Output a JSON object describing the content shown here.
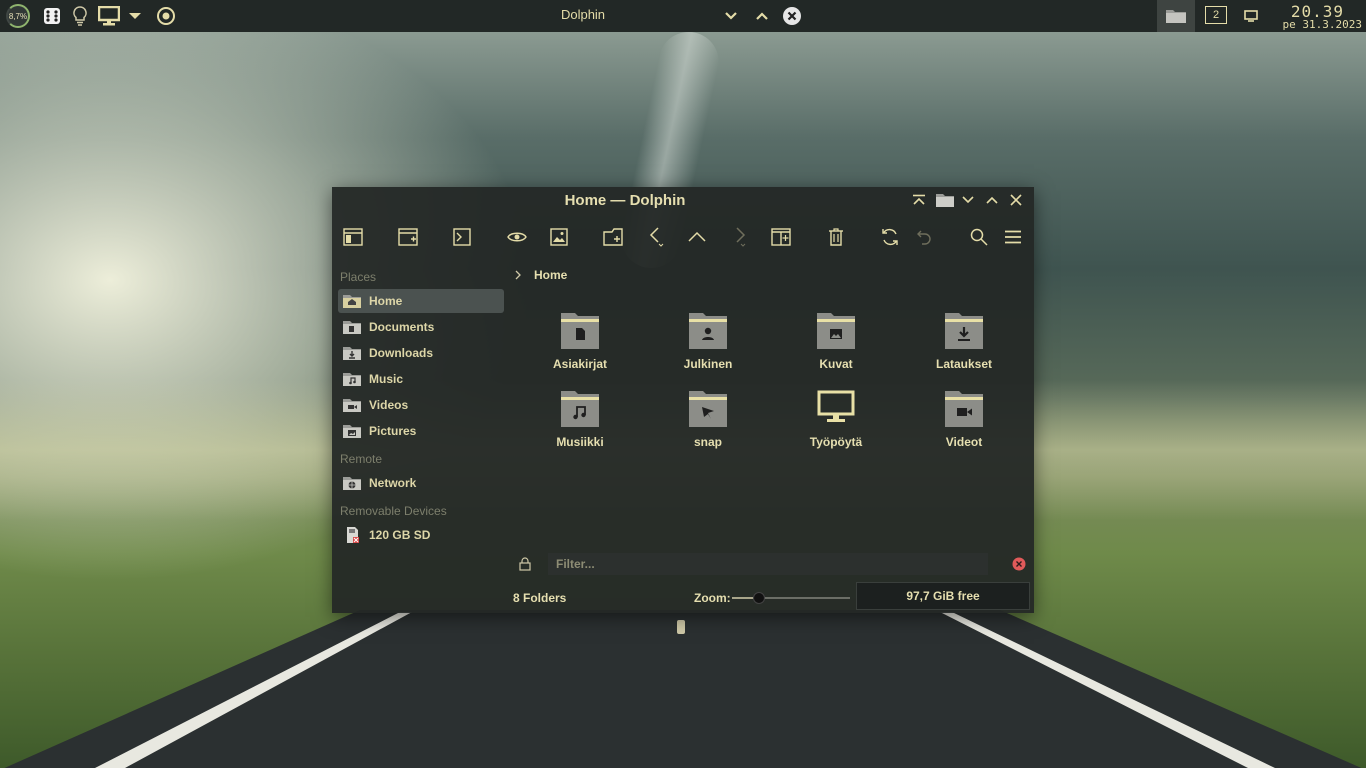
{
  "panel": {
    "cpu_load": "8,7%",
    "window_title": "Dolphin",
    "virtual_desktop": "2",
    "clock_time": "20.39",
    "clock_date": "pe 31.3.2023"
  },
  "window": {
    "title": "Home — Dolphin"
  },
  "sidebar": {
    "places_title": "Places",
    "places": [
      {
        "label": "Home",
        "icon": "home-icon"
      },
      {
        "label": "Documents",
        "icon": "documents-icon"
      },
      {
        "label": "Downloads",
        "icon": "downloads-icon"
      },
      {
        "label": "Music",
        "icon": "music-icon"
      },
      {
        "label": "Videos",
        "icon": "videos-icon"
      },
      {
        "label": "Pictures",
        "icon": "pictures-icon"
      }
    ],
    "remote_title": "Remote",
    "remote": [
      {
        "label": "Network",
        "icon": "network-icon"
      }
    ],
    "removable_title": "Removable Devices",
    "removable": [
      {
        "label": "120 GB SD",
        "icon": "sd-card-icon"
      }
    ]
  },
  "breadcrumb": {
    "current": "Home"
  },
  "files": [
    {
      "name": "Asiakirjat",
      "icon": "folder-documents-icon"
    },
    {
      "name": "Julkinen",
      "icon": "folder-public-icon"
    },
    {
      "name": "Kuvat",
      "icon": "folder-pictures-icon"
    },
    {
      "name": "Lataukset",
      "icon": "folder-downloads-icon"
    },
    {
      "name": "Musiikki",
      "icon": "folder-music-icon"
    },
    {
      "name": "snap",
      "icon": "folder-snap-icon"
    },
    {
      "name": "Työpöytä",
      "icon": "desktop-monitor-icon"
    },
    {
      "name": "Videot",
      "icon": "folder-videos-icon"
    }
  ],
  "filter": {
    "placeholder": "Filter..."
  },
  "status": {
    "summary": "8 Folders",
    "zoom_label": "Zoom:",
    "zoom_level": 0.2,
    "free_space": "97,7 GiB free"
  },
  "colors": {
    "accent": "#e4dca8",
    "panel_bg": "#222826",
    "window_bg": "#242826",
    "selection": "#4b5250",
    "folder_body": "#8c8d88",
    "folder_tab": "#e8e0a6"
  }
}
